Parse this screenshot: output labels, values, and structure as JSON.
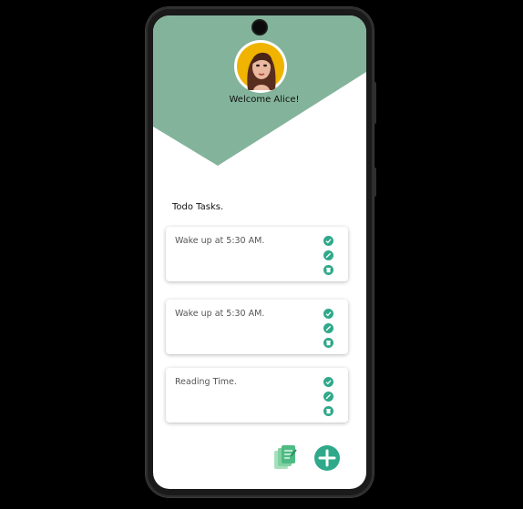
{
  "header": {
    "welcome_text": "Welcome Alice!",
    "accent_color": "#83b49b"
  },
  "tasks_section": {
    "title": "Todo Tasks."
  },
  "tasks": [
    {
      "text": "Wake up at 5:30 AM."
    },
    {
      "text": "Wake up at 5:30 AM."
    },
    {
      "text": "Reading Time."
    }
  ],
  "icons": {
    "complete": "check-circle-icon",
    "edit": "pencil-icon",
    "delete": "trash-icon",
    "documents": "documents-icon",
    "add": "plus-icon"
  },
  "colors": {
    "action_green": "#2fa98a",
    "avatar_bg": "#f0b400"
  }
}
